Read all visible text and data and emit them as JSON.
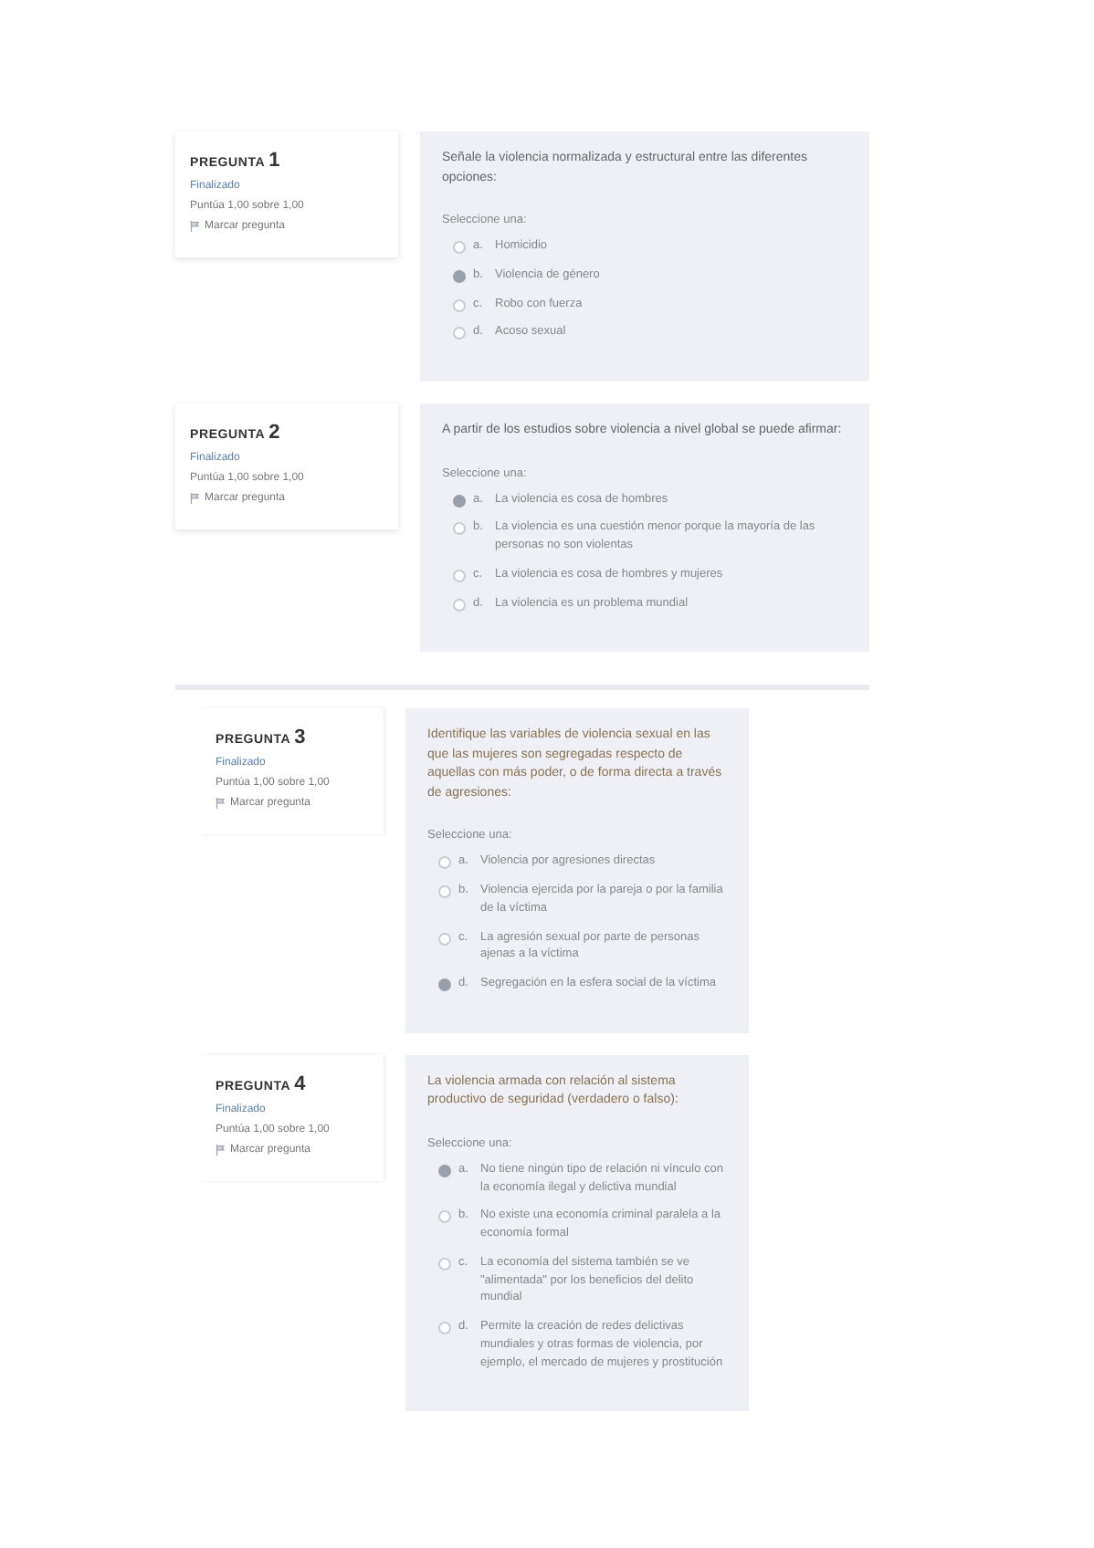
{
  "sections": [
    {
      "questions": [
        {
          "label": "PREGUNTA",
          "number": "1",
          "status": "Finalizado",
          "score": "Puntúa 1,00 sobre 1,00",
          "flag": "Marcar pregunta",
          "text": "Señale la violencia normalizada y estructural entre las diferentes opciones:",
          "prompt": "Seleccione una:",
          "options": [
            {
              "letter": "a.",
              "text": "Homicidio",
              "selected": false
            },
            {
              "letter": "b.",
              "text": "Violencia de género",
              "selected": true
            },
            {
              "letter": "c.",
              "text": "Robo con fuerza",
              "selected": false
            },
            {
              "letter": "d.",
              "text": "Acoso sexual",
              "selected": false
            }
          ]
        },
        {
          "label": "PREGUNTA",
          "number": "2",
          "status": "Finalizado",
          "score": "Puntúa 1,00 sobre 1,00",
          "flag": "Marcar pregunta",
          "text": "A partir de los estudios sobre violencia a nivel global se puede afirmar:",
          "prompt": "Seleccione una:",
          "options": [
            {
              "letter": "a.",
              "text": "La violencia es cosa de hombres",
              "selected": true
            },
            {
              "letter": "b.",
              "text": "La violencia es una cuestión menor porque la mayoría de las personas no son violentas",
              "selected": false
            },
            {
              "letter": "c.",
              "text": "La violencia es cosa de hombres y mujeres",
              "selected": false
            },
            {
              "letter": "d.",
              "text": "La violencia es un problema mundial",
              "selected": false
            }
          ]
        }
      ]
    },
    {
      "questions": [
        {
          "label": "PREGUNTA",
          "number": "3",
          "status": "Finalizado",
          "score": "Puntúa 1,00 sobre 1,00",
          "flag": "Marcar pregunta",
          "text": "Identifique las variables de violencia sexual en las que las mujeres son segregadas respecto de aquellas con más poder, o de forma directa a través de agresiones:",
          "prompt": "Seleccione una:",
          "options": [
            {
              "letter": "a.",
              "text": "Violencia por agresiones directas",
              "selected": false
            },
            {
              "letter": "b.",
              "text": "Violencia ejercida por la pareja o por la familia de la víctima",
              "selected": false
            },
            {
              "letter": "c.",
              "text": "La agresión sexual por parte de personas ajenas a la víctima",
              "selected": false
            },
            {
              "letter": "d.",
              "text": "Segregación en la esfera social de la víctima",
              "selected": true
            }
          ]
        },
        {
          "label": "PREGUNTA",
          "number": "4",
          "status": "Finalizado",
          "score": "Puntúa 1,00 sobre 1,00",
          "flag": "Marcar pregunta",
          "text": "La violencia armada con relación al sistema productivo de seguridad (verdadero o falso):",
          "prompt": "Seleccione una:",
          "options": [
            {
              "letter": "a.",
              "text": "No tiene ningún tipo de relación ni vínculo con la economía ilegal y delictiva mundial",
              "selected": true
            },
            {
              "letter": "b.",
              "text": "No existe una economía criminal paralela a la economía formal",
              "selected": false
            },
            {
              "letter": "c.",
              "text": "La economía del sistema también se ve \"alimentada\" por los beneficios del delito mundial",
              "selected": false
            },
            {
              "letter": "d.",
              "text": "Permite la creación de redes delictivas mundiales y otras formas de violencia, por ejemplo, el mercado de mujeres y prostitución",
              "selected": false
            }
          ]
        }
      ]
    }
  ]
}
